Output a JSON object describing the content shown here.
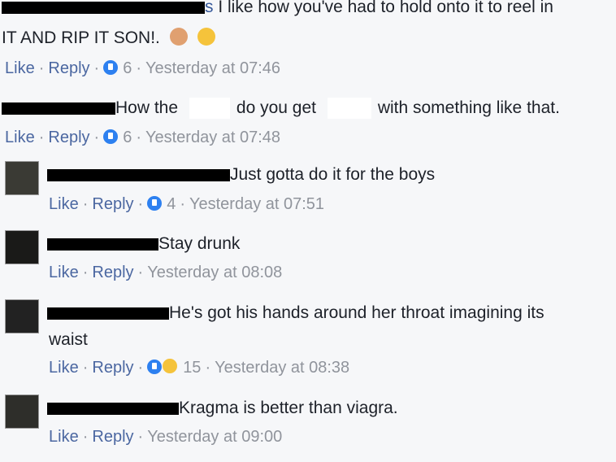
{
  "ui": {
    "like": "Like",
    "reply": "Reply",
    "sep": "·"
  },
  "comments": [
    {
      "name_suffix": "s",
      "text_1": "I like how you've had to hold onto it to reel in",
      "text_2": "IT AND RIP IT SON!.",
      "reaction_count": "6",
      "time": "Yesterday at 07:46",
      "emojis": [
        "ok-hand-emoji",
        "laughing-emoji"
      ]
    },
    {
      "text_a": "How the",
      "text_b": "do you get",
      "text_c": "with something like that.",
      "reaction_count": "6",
      "time": "Yesterday at 07:48"
    },
    {
      "text": "Just gotta do it for the boys",
      "reaction_count": "4",
      "time": "Yesterday at 07:51"
    },
    {
      "text": "Stay drunk",
      "time": "Yesterday at 08:08"
    },
    {
      "text_1": "He's got his hands around her throat imagining its",
      "text_2": "waist",
      "reaction_count": "15",
      "time": "Yesterday at 08:38"
    },
    {
      "text": "Kragma is better than viagra.",
      "time": "Yesterday at 09:00"
    }
  ]
}
